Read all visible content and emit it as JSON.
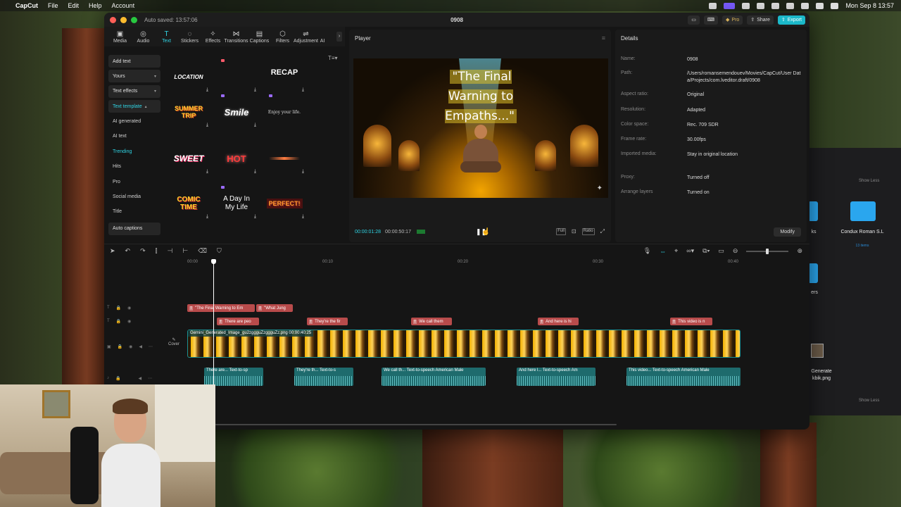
{
  "menubar": {
    "app": "CapCut",
    "items": [
      "File",
      "Edit",
      "Help",
      "Account"
    ],
    "clock": "Mon Sep 8  13:57"
  },
  "window": {
    "autosave": "Auto saved: 13:57:06",
    "title": "0908",
    "pro": "Pro",
    "share": "Share",
    "export": "Export"
  },
  "tools": [
    {
      "icon": "▣",
      "label": "Media"
    },
    {
      "icon": "◎",
      "label": "Audio"
    },
    {
      "icon": "T",
      "label": "Text"
    },
    {
      "icon": "◌",
      "label": "Stickers"
    },
    {
      "icon": "✧",
      "label": "Effects"
    },
    {
      "icon": "⋈",
      "label": "Transitions"
    },
    {
      "icon": "▤",
      "label": "Captions"
    },
    {
      "icon": "⬡",
      "label": "Filters"
    },
    {
      "icon": "⇌",
      "label": "Adjustment"
    },
    {
      "icon": "",
      "label": "AI"
    }
  ],
  "categories": {
    "add_text": "Add text",
    "yours": "Yours",
    "text_effects": "Text effects",
    "text_template": "Text template",
    "ai_generated": "AI generated",
    "ai_text": "AI text",
    "trending": "Trending",
    "hits": "Hits",
    "pro": "Pro",
    "social_media": "Social media",
    "title": "Title",
    "auto_captions": "Auto captions"
  },
  "templates": {
    "location": "LOCATION",
    "recap": "RECAP",
    "summer": "SUMMER TRIP",
    "smile": "Smile",
    "enjoy": "Enjoy your life.",
    "sweet": "SWEET",
    "hot": "HOT",
    "comic": "COMIC TIME",
    "aday": "A Day In My Life",
    "perfect": "PERFECT!"
  },
  "player": {
    "header": "Player",
    "overlay_title": "\"The Final Warning to Empaths...\"",
    "current_time": "00:00:01:28",
    "total_time": "00:00:50:17",
    "full": "Full",
    "ratio": "Ratio"
  },
  "details": {
    "header": "Details",
    "rows": [
      {
        "k": "Name:",
        "v": "0908"
      },
      {
        "k": "Path:",
        "v": "/Users/romansemendouev/Movies/CapCut/User Data/Projects/com.lveditor.draft/0908"
      },
      {
        "k": "Aspect ratio:",
        "v": "Original"
      },
      {
        "k": "Resolution:",
        "v": "Adapted"
      },
      {
        "k": "Color space:",
        "v": "Rec. 709 SDR"
      },
      {
        "k": "Frame rate:",
        "v": "30.00fps"
      },
      {
        "k": "Imported media:",
        "v": "Stay in original location"
      },
      {
        "k": "Proxy:",
        "v": "Turned off"
      },
      {
        "k": "Arrange layers",
        "v": "Turned on"
      }
    ],
    "modify": "Modify"
  },
  "timeline": {
    "ruler": [
      "00:00",
      "00:10",
      "00:20",
      "00:30",
      "00:40"
    ],
    "text_track1": [
      "\"The Final  Warning  to Em",
      "\"What Jung"
    ],
    "text_track2": [
      "There are peo",
      "They're the fir",
      "We call them",
      "And here is hi",
      "This video is n"
    ],
    "video_label": "Gemini_Generated_Image_gu2zggguZzggguZz.png  00:00:40:25",
    "cover": "Cover",
    "audio": [
      "There are...  Text-to-sp",
      "They're th...  Text-to-s",
      "We call th...  Text-to-speech American Male",
      "And here l...  Text-to-speech Am",
      "This video...  Text-to-speech American Male"
    ]
  },
  "finder": {
    "folder1": "Condux Roman S.L",
    "folder1_sub": "13 items",
    "partial1": "ks",
    "partial2": "ers",
    "file": "Generate",
    "file2": "kbik.png",
    "file_sub": "1,536",
    "show_less": "Show Less"
  }
}
